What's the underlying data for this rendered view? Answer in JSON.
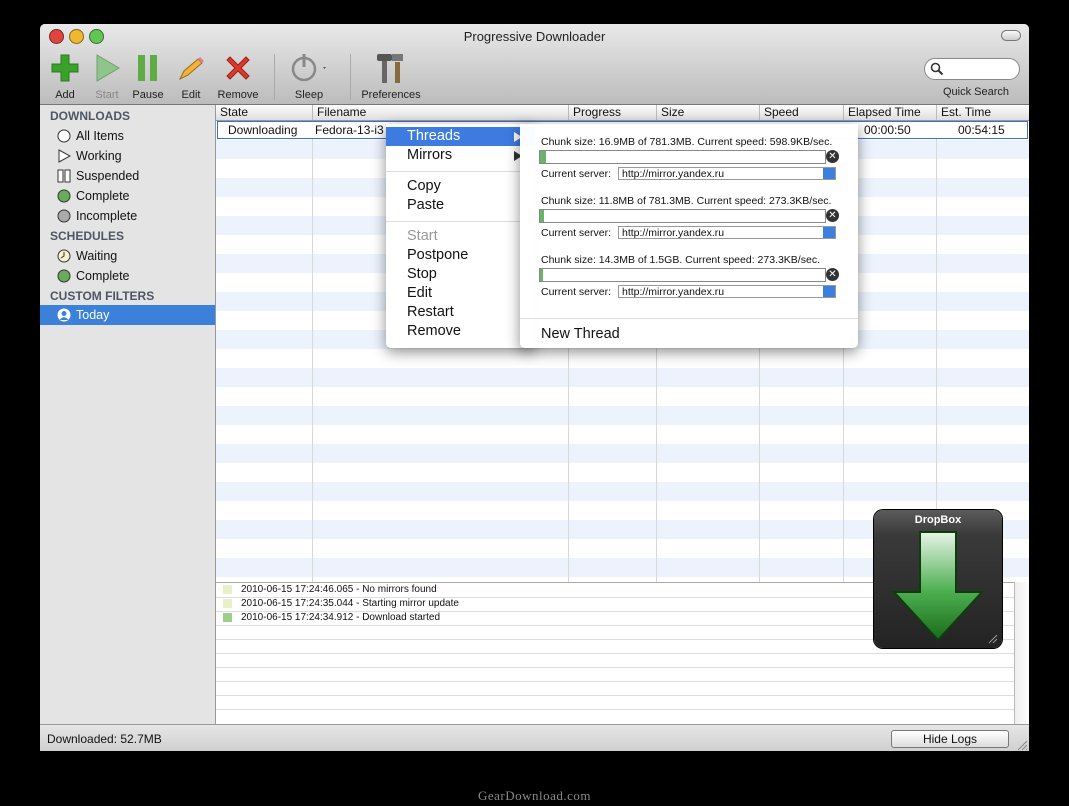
{
  "window": {
    "title": "Progressive Downloader"
  },
  "toolbar": {
    "add": "Add",
    "start": "Start",
    "pause": "Pause",
    "edit": "Edit",
    "remove": "Remove",
    "sleep": "Sleep",
    "preferences": "Preferences",
    "search_label": "Quick Search"
  },
  "sidebar": {
    "downloads_header": "DOWNLOADS",
    "downloads": [
      "All Items",
      "Working",
      "Suspended",
      "Complete",
      "Incomplete"
    ],
    "schedules_header": "SCHEDULES",
    "schedules": [
      "Waiting",
      "Complete"
    ],
    "filters_header": "CUSTOM FILTERS",
    "filters": [
      "Today"
    ]
  },
  "table": {
    "columns": [
      "State",
      "Filename",
      "Progress",
      "Size",
      "Speed",
      "Elapsed Time",
      "Est. Time"
    ],
    "row": {
      "state": "Downloading",
      "filename": "Fedora-13-i3",
      "elapsed": "00:00:50",
      "est": "00:54:15"
    }
  },
  "context_menu": {
    "threads": "Threads",
    "mirrors": "Mirrors",
    "copy": "Copy",
    "paste": "Paste",
    "start": "Start",
    "postpone": "Postpone",
    "stop": "Stop",
    "edit": "Edit",
    "restart": "Restart",
    "remove": "Remove"
  },
  "threads": {
    "server_label": "Current server:",
    "items": [
      {
        "chunk": "Chunk size: 16.9MB of 781.3MB. Current speed: 598.9KB/sec.",
        "server": "http://mirror.yandex.ru",
        "progress": 0.02
      },
      {
        "chunk": "Chunk size: 11.8MB of 781.3MB. Current speed: 273.3KB/sec.",
        "server": "http://mirror.yandex.ru",
        "progress": 0.015
      },
      {
        "chunk": "Chunk size: 14.3MB of 1.5GB. Current speed: 273.3KB/sec.",
        "server": "http://mirror.yandex.ru",
        "progress": 0.01
      }
    ],
    "new_thread": "New Thread"
  },
  "logs": [
    {
      "text": "2010-06-15 17:24:46.065 - No mirrors found",
      "color": "#e8f0c8"
    },
    {
      "text": "2010-06-15 17:24:35.044 - Starting mirror update",
      "color": "#e8f0c8"
    },
    {
      "text": "2010-06-15 17:24:34.912 - Download started",
      "color": "#9ccf8a"
    }
  ],
  "status": {
    "downloaded": "Downloaded: 52.7MB",
    "hide_logs": "Hide Logs"
  },
  "dropbox": {
    "title": "DropBox"
  },
  "watermark": "GearDownload.com",
  "colors": {
    "accent": "#3b80d9",
    "stripe": "#edf3fd",
    "add_green": "#3aa12a",
    "remove_red": "#d93a2b",
    "dropbox_green": "#2f8f2f"
  }
}
